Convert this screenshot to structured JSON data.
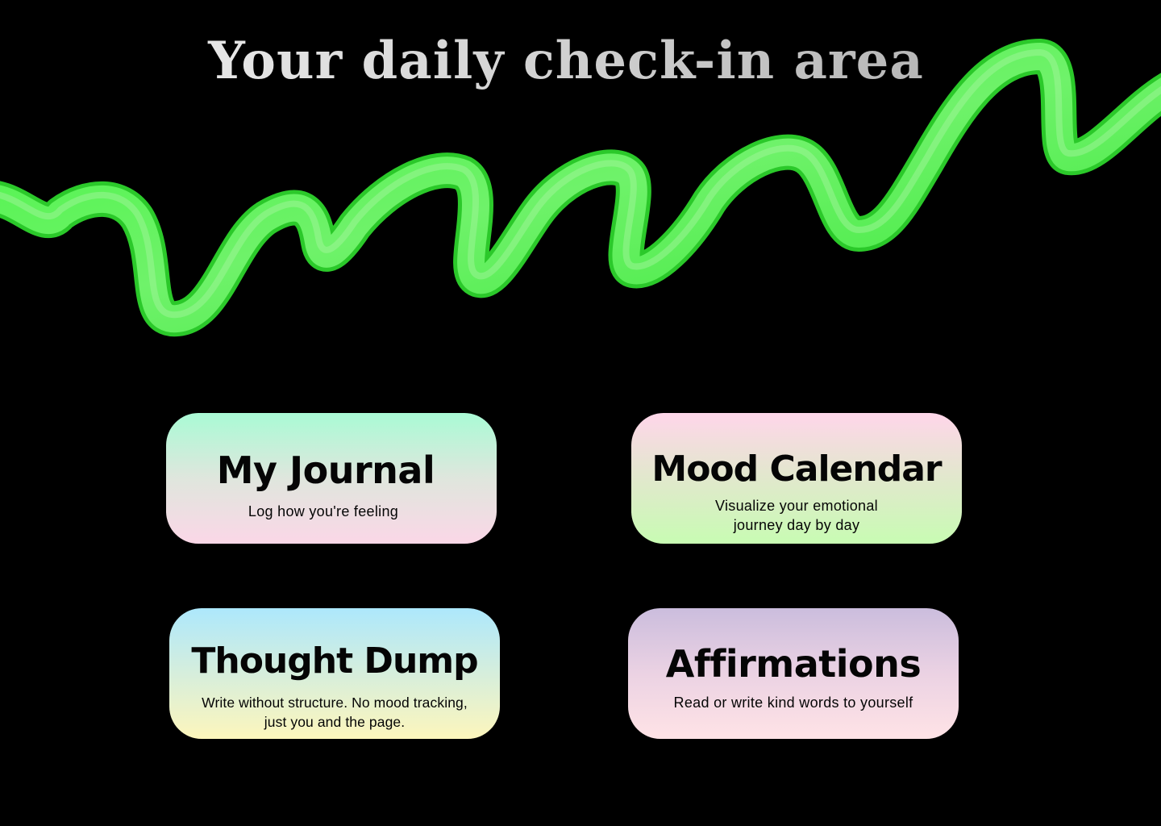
{
  "page": {
    "title": "Your daily check-in area"
  },
  "decoration": {
    "icon": "green-squiggle",
    "color": "#3ef23e"
  },
  "cards": [
    {
      "id": "journal",
      "title": "My Journal",
      "subtitle": "Log how you're feeling"
    },
    {
      "id": "mood",
      "title": "Mood Calendar",
      "subtitle_line1": "Visualize your emotional",
      "subtitle_line2": "journey day by day"
    },
    {
      "id": "thought",
      "title": "Thought Dump",
      "subtitle_line1": "Write without structure. No mood tracking,",
      "subtitle_line2": "just you and the page."
    },
    {
      "id": "affirm",
      "title": "Affirmations",
      "subtitle": "Read or write kind words to yourself"
    }
  ]
}
